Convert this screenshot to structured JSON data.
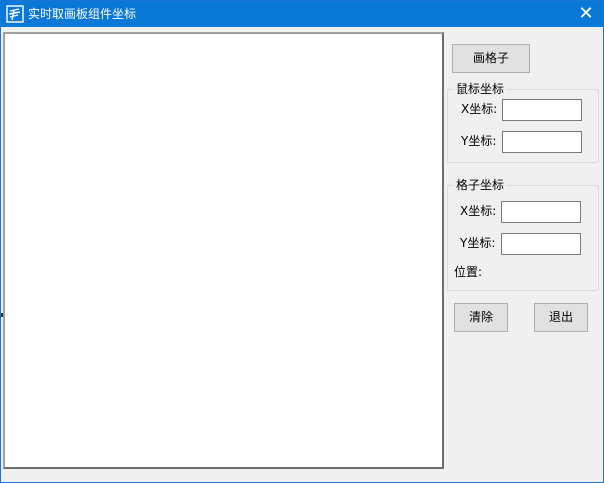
{
  "window": {
    "title": "实时取画板组件坐标",
    "close_glyph": "✕"
  },
  "controls": {
    "draw_grid_label": "画格子",
    "clear_label": "清除",
    "exit_label": "退出"
  },
  "mouse_group": {
    "title": "鼠标坐标",
    "x_label": "X坐标:",
    "y_label": "Y坐标:",
    "x_value": "",
    "y_value": ""
  },
  "grid_group": {
    "title": "格子坐标",
    "x_label": "X坐标:",
    "y_label": "Y坐标:",
    "x_value": "",
    "y_value": "",
    "position_label": "位置:"
  },
  "icons": {
    "app": "app-logo-icon",
    "close": "close-icon"
  },
  "colors": {
    "titlebar": "#0a78d7",
    "window_bg": "#f0f0f0",
    "canvas_bg": "#ffffff"
  }
}
